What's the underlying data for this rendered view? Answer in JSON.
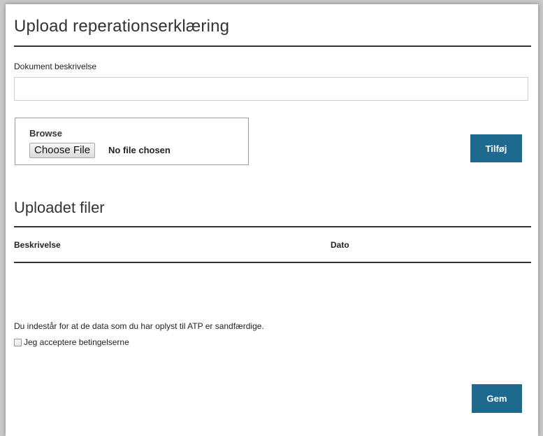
{
  "form": {
    "title": "Upload reperationserklæring",
    "document_description_label": "Dokument beskrivelse",
    "document_description_value": "",
    "document_description_placeholder": "",
    "browse_label": "Browse",
    "choose_file_label": "Choose File",
    "no_file_text": "No file chosen",
    "add_button_label": "Tilføj"
  },
  "uploaded": {
    "title": "Uploadet filer",
    "columns": [
      "Beskrivelse",
      "Dato"
    ],
    "rows": []
  },
  "terms": {
    "declaration": "Du indestår for at de data som du har oplyst til ATP er sandfærdige.",
    "accept_label": "Jeg acceptere betingelserne",
    "accepted": false
  },
  "actions": {
    "save_label": "Gem"
  },
  "colors": {
    "primary_button": "#1e6a8e",
    "rule": "#333333",
    "background": "#ffffff"
  }
}
